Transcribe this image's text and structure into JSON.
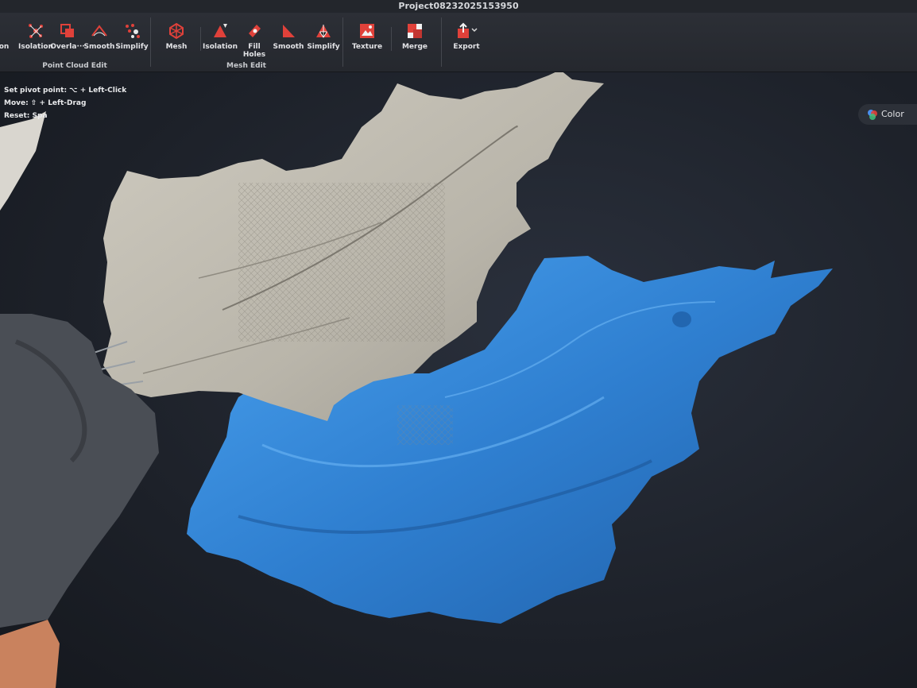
{
  "window": {
    "title": "Project08232025153950"
  },
  "toolbar": {
    "point_cloud_edit": {
      "label": "Point Cloud Edit",
      "tools": [
        "on",
        "Isolation",
        "Overla···",
        "Smooth",
        "Simplify"
      ]
    },
    "mesh_edit": {
      "label": "Mesh Edit",
      "tools": [
        "Mesh",
        "Isolation",
        "Fill Holes",
        "Smooth",
        "Simplify"
      ]
    },
    "texture": "Texture",
    "merge": "Merge",
    "export": "Export"
  },
  "hints": {
    "pivot": "Set pivot point: ⌥ + Left-Click",
    "move": "Move: ⇧ + Left-Drag",
    "reset": "Reset: Spa"
  },
  "color_button": {
    "label": "Color"
  },
  "colors": {
    "accent": "#e0413a",
    "scan_original": "#b9b5aa",
    "scan_mesh": "#2f7fd0"
  }
}
